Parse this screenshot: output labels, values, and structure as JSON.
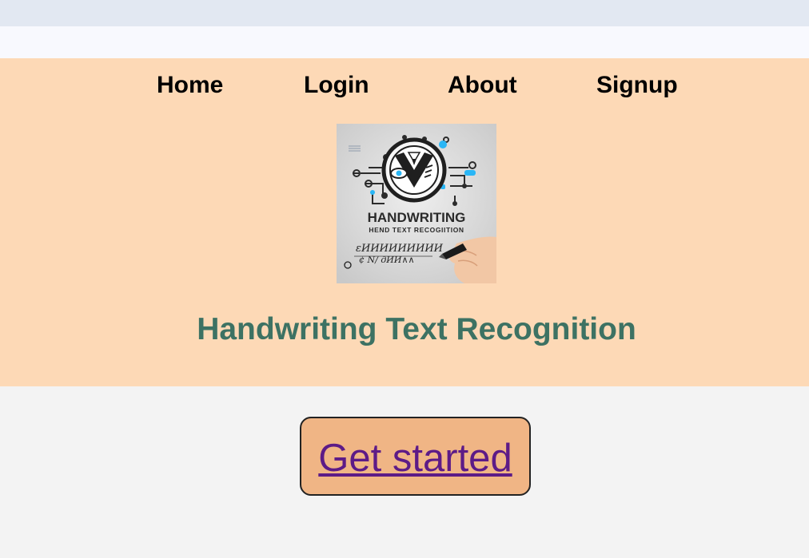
{
  "nav": {
    "items": [
      {
        "label": "Home"
      },
      {
        "label": "Login"
      },
      {
        "label": "About"
      },
      {
        "label": "Signup"
      }
    ]
  },
  "logo": {
    "title": "HANDWRITING",
    "subtitle": "HEND TEXT RECOGIITION",
    "scribble_1": "εИИИИИИИИИ",
    "scribble_2": "¢ N/ дИИ∧∧"
  },
  "page": {
    "title": "Handwriting Text Recognition"
  },
  "cta": {
    "label": "Get started"
  },
  "colors": {
    "topbar": "#e2e8f2",
    "hero_background": "#fdd9b6",
    "title": "#3d7263",
    "cta_background": "#f0b585",
    "cta_text": "#5d1b87",
    "accent_blue": "#29b6f6"
  }
}
